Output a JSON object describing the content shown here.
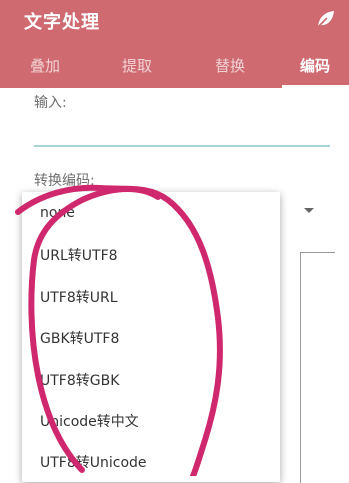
{
  "app": {
    "title": "文字处理",
    "icon": "leaf-icon"
  },
  "tabs": [
    {
      "label": "叠加",
      "active": false
    },
    {
      "label": "提取",
      "active": false
    },
    {
      "label": "替换",
      "active": false
    },
    {
      "label": "编码",
      "active": true
    }
  ],
  "form": {
    "input_label": "输入:",
    "encoding_label": "转换编码:",
    "selected_option": "none"
  },
  "dropdown": {
    "options": [
      "none",
      "URL转UTF8",
      "UTF8转URL",
      "GBK转UTF8",
      "UTF8转GBK",
      "Unicode转中文",
      "UTF8转Unicode"
    ]
  },
  "colors": {
    "app_bar": "#cf6a70",
    "input_underline": "#a7d3d5",
    "annotation": "#d0286e"
  }
}
